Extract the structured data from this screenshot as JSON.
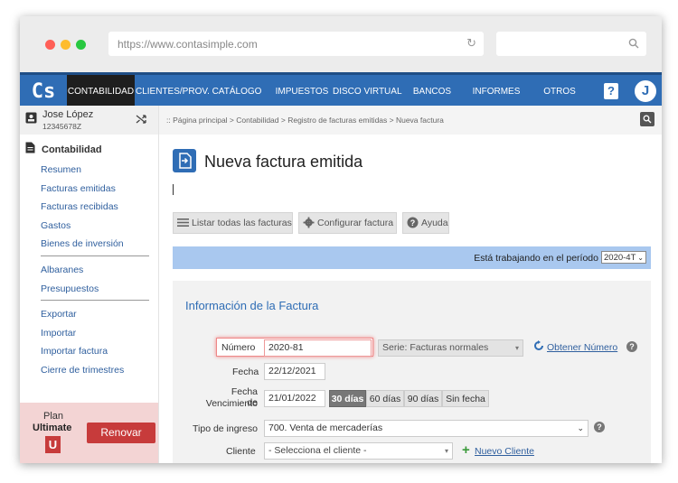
{
  "browser": {
    "url": "https://www.contasimple.com",
    "dot_colors": [
      "#ff5f57",
      "#febc2e",
      "#28c840"
    ]
  },
  "nav": {
    "logo": "Cs",
    "items": [
      "CONTABILIDAD",
      "CLIENTES/PROV.",
      "CATÁLOGO",
      "IMPUESTOS",
      "DISCO VIRTUAL",
      "BANCOS",
      "INFORMES",
      "OTROS"
    ],
    "help": "?",
    "avatar_letter": "J",
    "brand_color": "#2f6db5"
  },
  "user": {
    "name": "Jose López",
    "id": "12345678Z"
  },
  "sidebar": {
    "section": "Contabilidad",
    "group1": [
      "Resumen",
      "Facturas emitidas",
      "Facturas recibidas",
      "Gastos",
      "Bienes de inversión"
    ],
    "group2": [
      "Albaranes",
      "Presupuestos"
    ],
    "group3": [
      "Exportar",
      "Importar",
      "Importar factura",
      "Cierre de trimestres"
    ]
  },
  "plan": {
    "label": "Plan",
    "name": "Ultimate",
    "badge": "U",
    "renew_button": "Renovar"
  },
  "breadcrumb": ":: Página principal > Contabilidad > Registro de facturas emitidas > Nueva factura",
  "page": {
    "title": "Nueva factura emitida"
  },
  "toolbar": {
    "list_all": "Listar todas las facturas",
    "configure": "Configurar factura",
    "help": "Ayuda"
  },
  "period": {
    "label": "Está trabajando en el período",
    "value": "2020-4T"
  },
  "form": {
    "heading": "Información de la Factura",
    "numero_label": "Número",
    "numero_value": "2020-81",
    "serie_value": "Serie: Facturas normales",
    "obtener_numero": "Obtener Número",
    "fecha_label": "Fecha",
    "fecha_value": "22/12/2021",
    "vencimiento_label_1": "Fecha de",
    "vencimiento_label_2": "Vencimiento",
    "vencimiento_value": "21/01/2022",
    "vencimiento_options": [
      "30 días",
      "60 días",
      "90 días",
      "Sin fecha"
    ],
    "tipo_ingreso_label": "Tipo de ingreso",
    "tipo_ingreso_value": "700. Venta de mercaderías",
    "cliente_label": "Cliente",
    "cliente_placeholder": "- Selecciona el cliente -",
    "nuevo_cliente": "Nuevo Cliente"
  }
}
